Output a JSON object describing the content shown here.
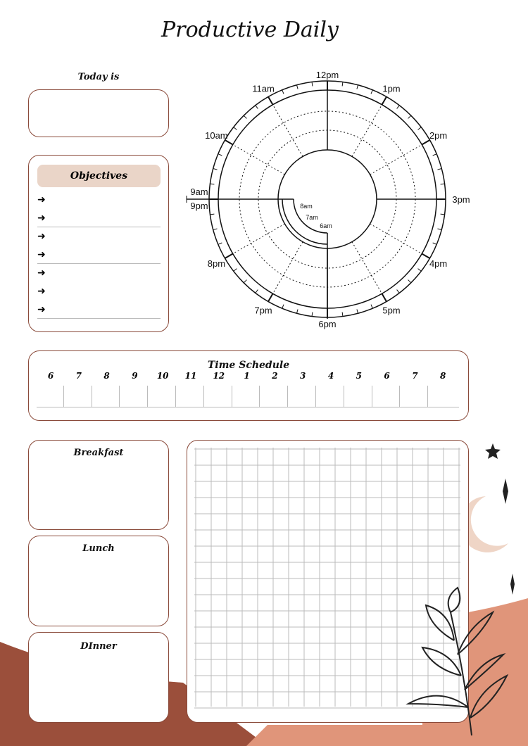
{
  "title": "Productive Daily",
  "today_label": "Today is",
  "objectives": {
    "title": "Objectives",
    "bullet": "➜",
    "count": 7
  },
  "clock": {
    "outer_labels": [
      "12pm",
      "1pm",
      "2pm",
      "3pm",
      "4pm",
      "5pm",
      "6pm",
      "7pm",
      "8pm",
      "9pm",
      "10am",
      "11am"
    ],
    "left_extra": "9am",
    "inner_labels": [
      "8am",
      "7am",
      "6am"
    ]
  },
  "schedule": {
    "title": "Time Schedule",
    "hours": [
      "6",
      "7",
      "8",
      "9",
      "10",
      "11",
      "12",
      "1",
      "2",
      "3",
      "4",
      "5",
      "6",
      "7",
      "8"
    ]
  },
  "meals": {
    "breakfast": "Breakfast",
    "lunch": "Lunch",
    "dinner": "DInner"
  },
  "colors": {
    "border": "#8a4a3a",
    "brown": "#9b4f3b",
    "salmon": "#e0957a",
    "moon": "#efd5c6",
    "label_bg": "#ead5c8"
  }
}
